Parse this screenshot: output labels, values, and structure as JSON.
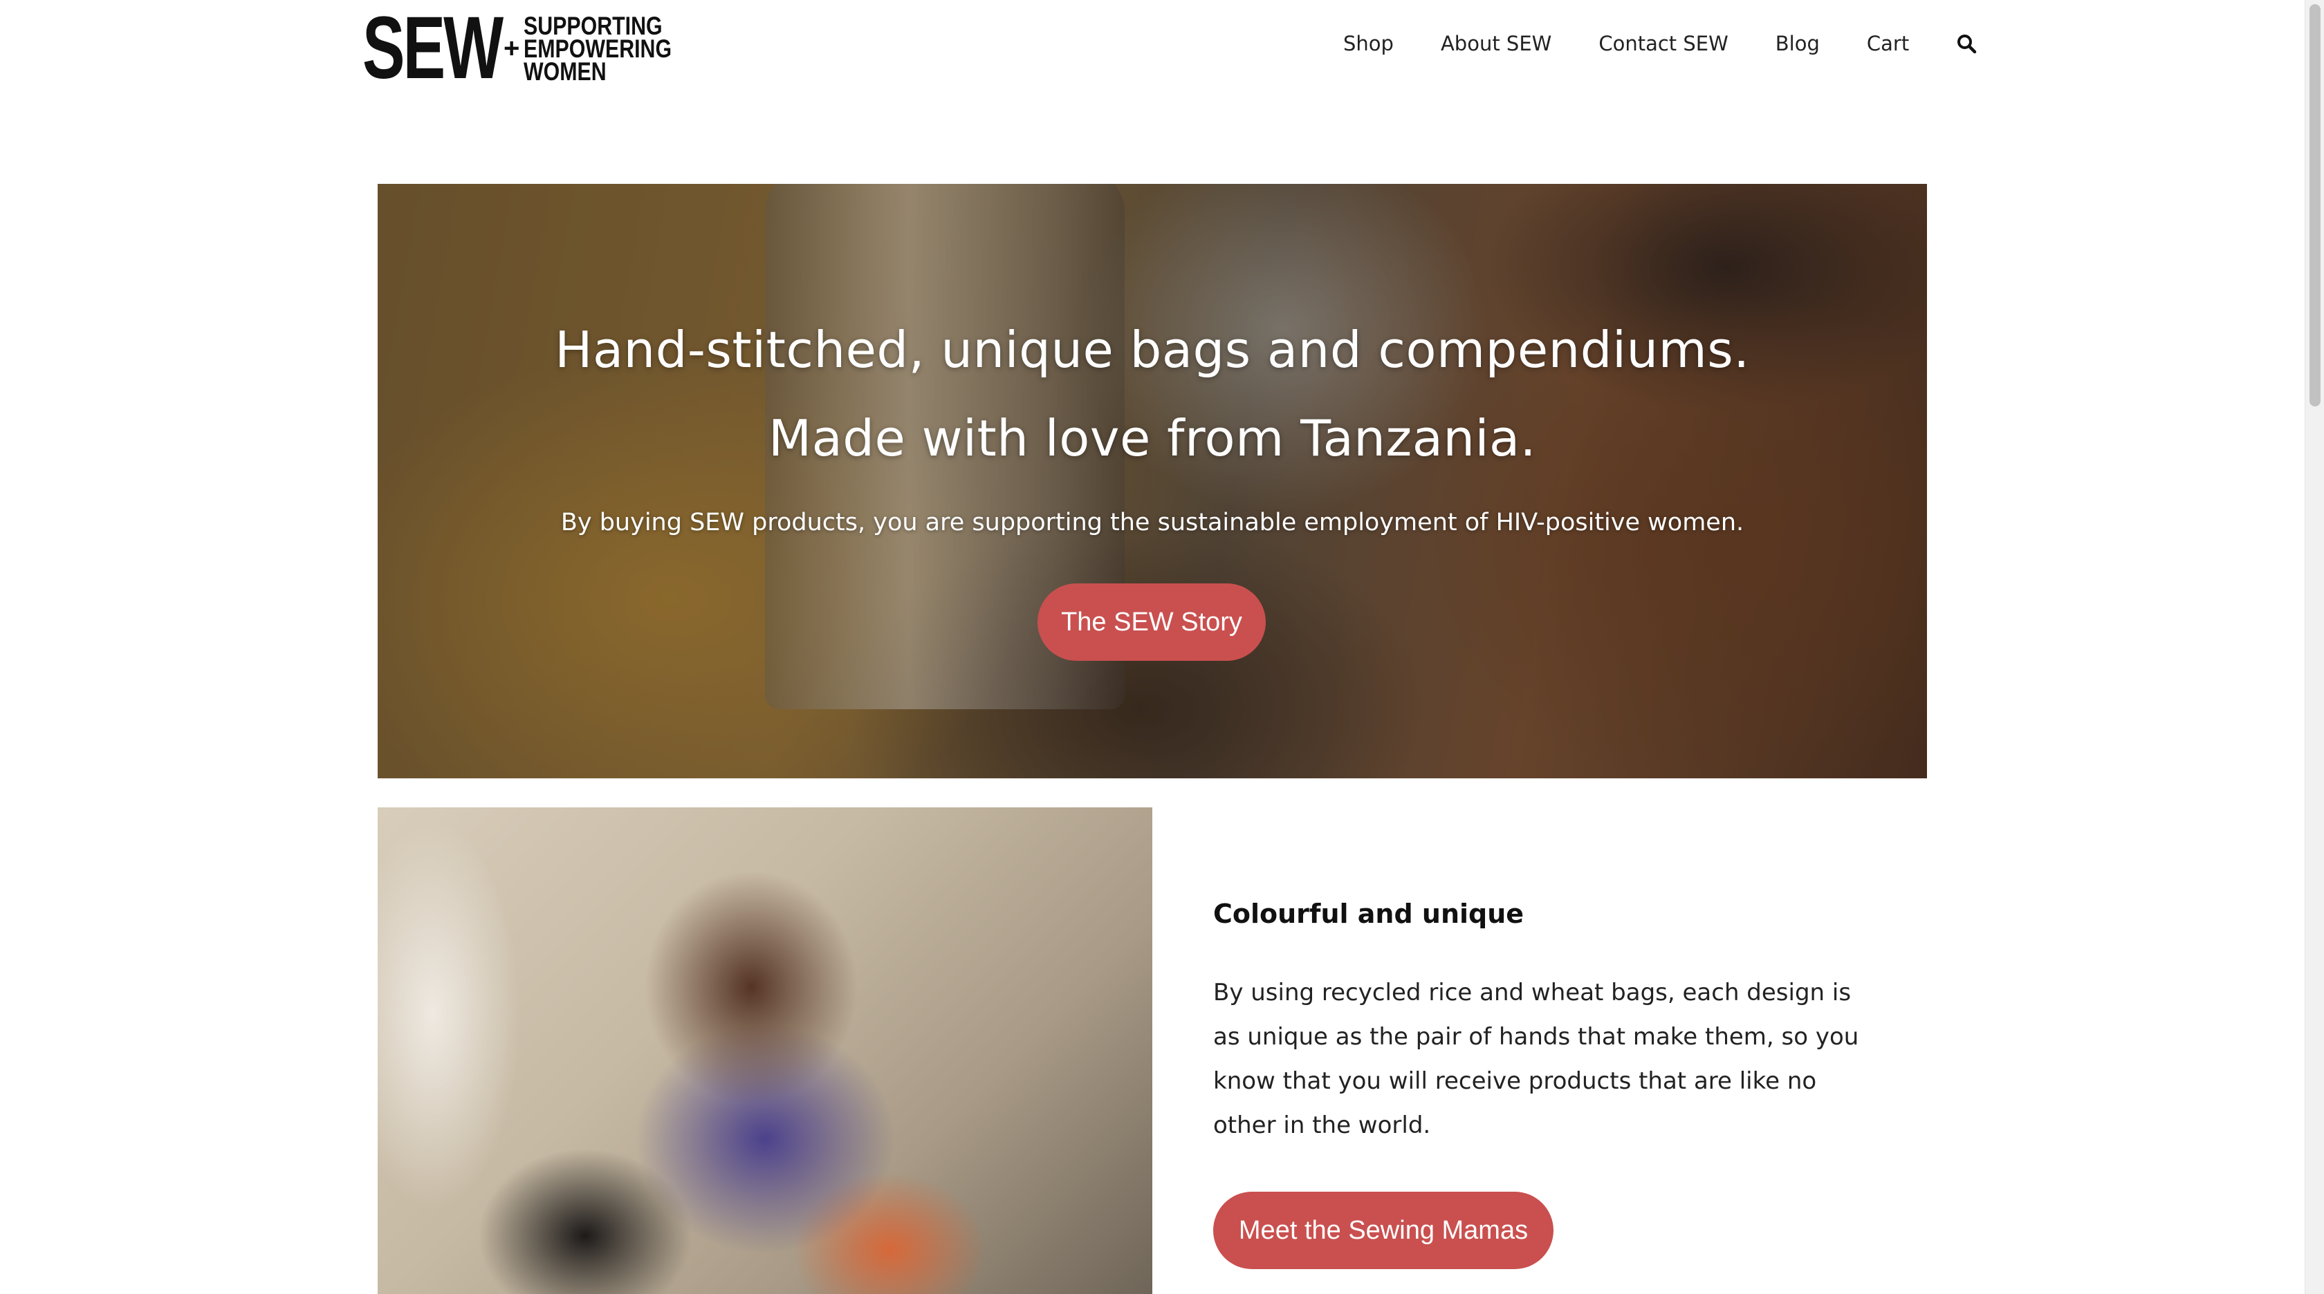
{
  "logo": {
    "wordmark": "SEW",
    "plus": "+",
    "lines": [
      "SUPPORTING",
      "EMPOWERING",
      "WOMEN"
    ]
  },
  "nav": {
    "items": [
      "Shop",
      "About SEW",
      "Contact SEW",
      "Blog",
      "Cart"
    ],
    "search_icon": "search-icon"
  },
  "hero": {
    "title_line1": "Hand-stitched, unique bags and compendiums.",
    "title_line2": "Made with love from Tanzania.",
    "subtitle": "By buying SEW products, you are supporting the sustainable employment of HIV-positive women.",
    "button_label": "The SEW Story"
  },
  "feature": {
    "heading": "Colourful and unique",
    "body": "By using recycled rice and wheat bags, each design is as unique as the pair of hands that make them, so you know that you will receive products that are like no other in the world.",
    "button_label": "Meet the Sewing Mamas"
  },
  "colors": {
    "accent": "#c9504f",
    "text": "#1c1c1c",
    "background": "#ffffff"
  }
}
